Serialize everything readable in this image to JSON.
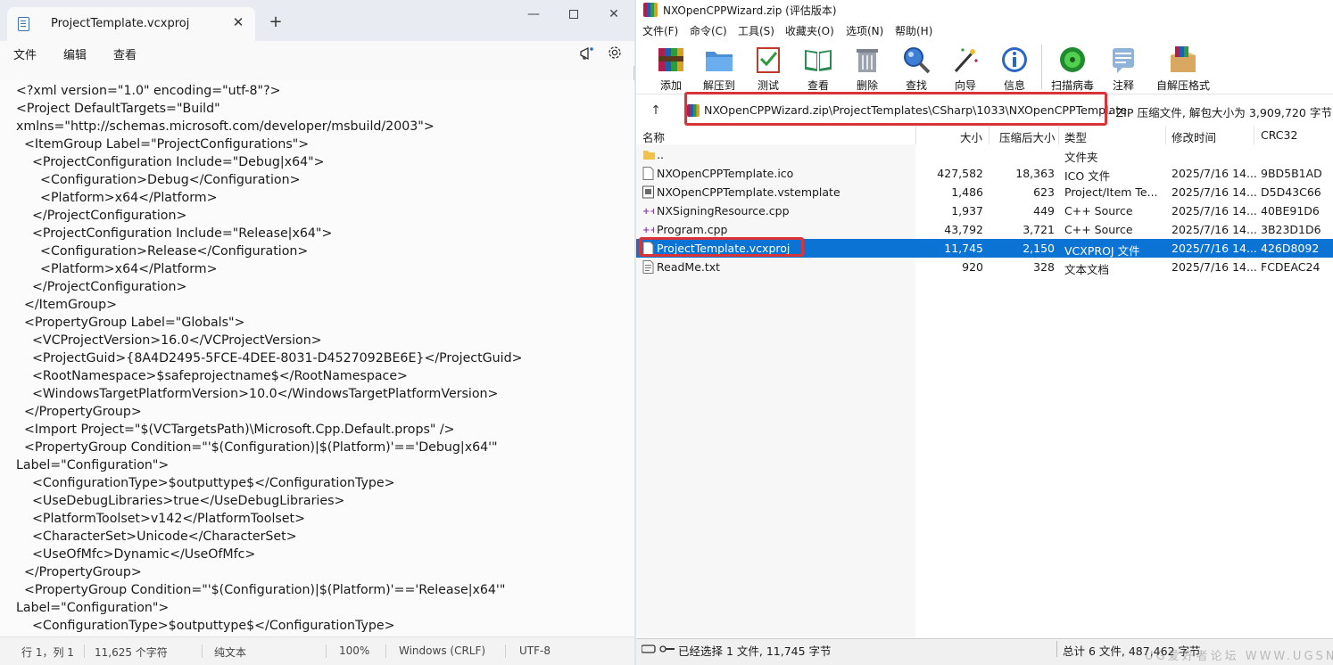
{
  "notepad": {
    "tab_title": "ProjectTemplate.vcxproj",
    "close_glyph": "✕",
    "newtab_glyph": "+",
    "min_glyph": "—",
    "close_window_glyph": "✕",
    "menu": {
      "file": "文件",
      "edit": "编辑",
      "view": "查看"
    },
    "lines": [
      "<?xml version=\"1.0\" encoding=\"utf-8\"?>",
      "<Project DefaultTargets=\"Build\"",
      "xmlns=\"http://schemas.microsoft.com/developer/msbuild/2003\">",
      "  <ItemGroup Label=\"ProjectConfigurations\">",
      "    <ProjectConfiguration Include=\"Debug|x64\">",
      "      <Configuration>Debug</Configuration>",
      "      <Platform>x64</Platform>",
      "    </ProjectConfiguration>",
      "    <ProjectConfiguration Include=\"Release|x64\">",
      "      <Configuration>Release</Configuration>",
      "      <Platform>x64</Platform>",
      "    </ProjectConfiguration>",
      "  </ItemGroup>",
      "  <PropertyGroup Label=\"Globals\">",
      "    <VCProjectVersion>16.0</VCProjectVersion>",
      "    <ProjectGuid>{8A4D2495-5FCE-4DEE-8031-D4527092BE6E}</ProjectGuid>",
      "    <RootNamespace>$safeprojectname$</RootNamespace>",
      "    <WindowsTargetPlatformVersion>10.0</WindowsTargetPlatformVersion>",
      "  </PropertyGroup>",
      "  <Import Project=\"$(VCTargetsPath)\\Microsoft.Cpp.Default.props\" />",
      "  <PropertyGroup Condition=\"'$(Configuration)|$(Platform)'=='Debug|x64'\"",
      "Label=\"Configuration\">",
      "    <ConfigurationType>$outputtype$</ConfigurationType>",
      "    <UseDebugLibraries>true</UseDebugLibraries>",
      "    <PlatformToolset>v142</PlatformToolset>",
      "    <CharacterSet>Unicode</CharacterSet>",
      "    <UseOfMfc>Dynamic</UseOfMfc>",
      "  </PropertyGroup>",
      "  <PropertyGroup Condition=\"'$(Configuration)|$(Platform)'=='Release|x64'\"",
      "Label=\"Configuration\">",
      "    <ConfigurationType>$outputtype$</ConfigurationType>"
    ],
    "status": {
      "position": "行 1，列 1",
      "chars": "11,625 个字符",
      "format": "纯文本",
      "zoom": "100%",
      "eol": "Windows (CRLF)",
      "encoding": "UTF-8"
    }
  },
  "winrar": {
    "title": "NXOpenCPPWizard.zip (评估版本)",
    "menu": [
      "文件(F)",
      "命令(C)",
      "工具(S)",
      "收藏夹(O)",
      "选项(N)",
      "帮助(H)"
    ],
    "toolbar": [
      "添加",
      "解压到",
      "测试",
      "查看",
      "删除",
      "查找",
      "向导",
      "信息",
      "扫描病毒",
      "注释",
      "自解压格式"
    ],
    "up_glyph": "↑",
    "path": "NXOpenCPPWizard.zip\\ProjectTemplates\\CSharp\\1033\\NXOpenCPPTemplate",
    "path_info": "- ZIP 压缩文件, 解包大小为 3,909,720 字节",
    "columns": {
      "name": "名称",
      "size": "大小",
      "packed": "压缩后大小",
      "type": "类型",
      "modified": "修改时间",
      "crc": "CRC32"
    },
    "rows": [
      {
        "icon": "folder",
        "name": "..",
        "size": "",
        "packed": "",
        "type": "文件夹",
        "modified": "",
        "crc": ""
      },
      {
        "icon": "file",
        "name": "NXOpenCPPTemplate.ico",
        "size": "427,582",
        "packed": "18,363",
        "type": "ICO 文件",
        "modified": "2025/7/16 14...",
        "crc": "9BD5B1AD"
      },
      {
        "icon": "template",
        "name": "NXOpenCPPTemplate.vstemplate",
        "size": "1,486",
        "packed": "623",
        "type": "Project/Item Te...",
        "modified": "2025/7/16 14...",
        "crc": "D5D43C66"
      },
      {
        "icon": "cpp",
        "name": "NXSigningResource.cpp",
        "size": "1,937",
        "packed": "449",
        "type": "C++ Source",
        "modified": "2025/7/16 14...",
        "crc": "40BE91D6"
      },
      {
        "icon": "cpp",
        "name": "Program.cpp",
        "size": "43,792",
        "packed": "3,721",
        "type": "C++ Source",
        "modified": "2025/7/16 14...",
        "crc": "3B23D1D6"
      },
      {
        "icon": "file",
        "name": "ProjectTemplate.vcxproj",
        "size": "11,745",
        "packed": "2,150",
        "type": "VCXPROJ 文件",
        "modified": "2025/7/16 14...",
        "crc": "426D8092",
        "selected": true
      },
      {
        "icon": "text",
        "name": "ReadMe.txt",
        "size": "920",
        "packed": "328",
        "type": "文本文档",
        "modified": "2025/7/16 14...",
        "crc": "FCDEAC24"
      }
    ],
    "status": {
      "left": "已经选择 1 文件, 11,745 字节",
      "right": "总计 6 文件, 487,462 字节"
    },
    "watermark": "UG爱好者论坛  WWW.UGSNX.COM"
  },
  "colors": {
    "selection": "#0a73d4",
    "highlight_box": "#d8343a"
  }
}
